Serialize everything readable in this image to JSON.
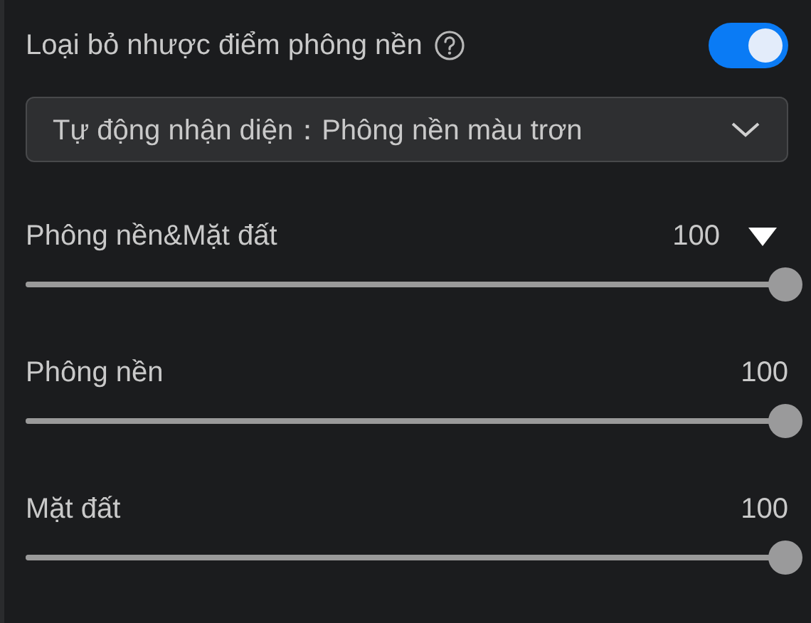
{
  "header": {
    "title": "Loại bỏ nhược điểm phông nền",
    "on": true
  },
  "mode_select": {
    "value": "Tự động nhận diện：Phông nền màu trơn"
  },
  "sliders": [
    {
      "kind": "group",
      "label": "Phông nền&Mặt đất",
      "reading": "100",
      "level": 1
    },
    {
      "kind": "plain",
      "label": "Phông nền",
      "reading": "100",
      "level": 1
    },
    {
      "kind": "plain",
      "label": "Mặt đất",
      "reading": "100",
      "level": 1
    }
  ]
}
